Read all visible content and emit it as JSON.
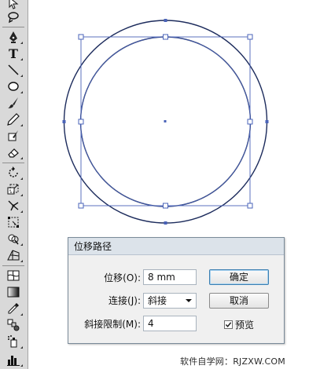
{
  "dialog": {
    "title": "位移路径",
    "offset_label": "位移(O):",
    "offset_value": "8 mm",
    "join_label": "连接(J):",
    "join_value": "斜接",
    "miter_label": "斜接限制(M):",
    "miter_value": "4",
    "ok_label": "确定",
    "cancel_label": "取消",
    "preview_label": "预览",
    "preview_checked": true
  },
  "toolbar": {
    "type_glyph": "T",
    "tools": [
      "selection-tool",
      "lasso-tool",
      "pen-tool",
      "type-tool",
      "line-tool",
      "ellipse-tool",
      "paintbrush-tool",
      "pencil-tool",
      "eraser-tool",
      "rotate-tool",
      "scale-tool",
      "warp-tool",
      "free-transform-tool",
      "shape-builder-tool",
      "perspective-grid-tool",
      "mesh-tool",
      "gradient-tool",
      "eyedropper-tool",
      "blend-tool",
      "symbol-sprayer-tool",
      "column-graph-tool"
    ]
  },
  "colors": {
    "selection": "#4a63b8",
    "path": "#1c2b5c",
    "toolbar_bg": "#d9d9d9",
    "dialog_bg": "#f0f0f0"
  },
  "watermark": "软件自学网：RJZXW.COM"
}
